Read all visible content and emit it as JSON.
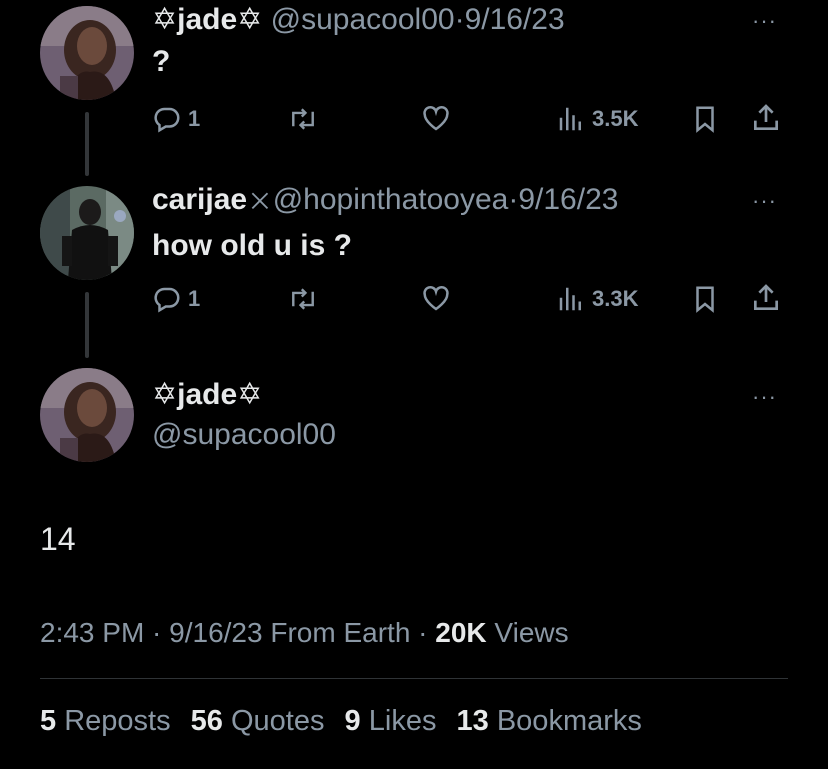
{
  "tweet1": {
    "name": "✡jade✡",
    "handle": "@supacool00",
    "separator": "·",
    "date": "9/16/23",
    "text": "?",
    "more": "···",
    "replies": "1",
    "views": "3.5K"
  },
  "tweet2": {
    "name": "carijae",
    "verified_mark": "⨉",
    "handle": "@hopinthatooyea",
    "separator": "·",
    "date": "9/16/23",
    "text": "how old u is ?",
    "more": "···",
    "replies": "1",
    "views": "3.3K"
  },
  "main": {
    "name": "✡jade✡",
    "handle": "@supacool00",
    "more": "···",
    "text": "14",
    "time": "2:43 PM · 9/16/23 From Earth · ",
    "views_count": "20K",
    "views_label": " Views"
  },
  "stats": {
    "reposts_count": "5",
    "reposts_label": " Reposts",
    "quotes_count": "56",
    "quotes_label": " Quotes",
    "likes_count": "9",
    "likes_label": " Likes",
    "bookmarks_count": "13",
    "bookmarks_label": " Bookmarks"
  },
  "icons": {
    "reply": "reply-icon",
    "repost": "repost-icon",
    "like": "heart-icon",
    "views": "views-icon",
    "bookmark": "bookmark-icon",
    "share": "share-icon",
    "more": "more-icon"
  },
  "colors": {
    "background": "#000000",
    "primary_text": "#e7e9ea",
    "secondary_text": "#8b98a5",
    "divider": "#2f3336"
  }
}
